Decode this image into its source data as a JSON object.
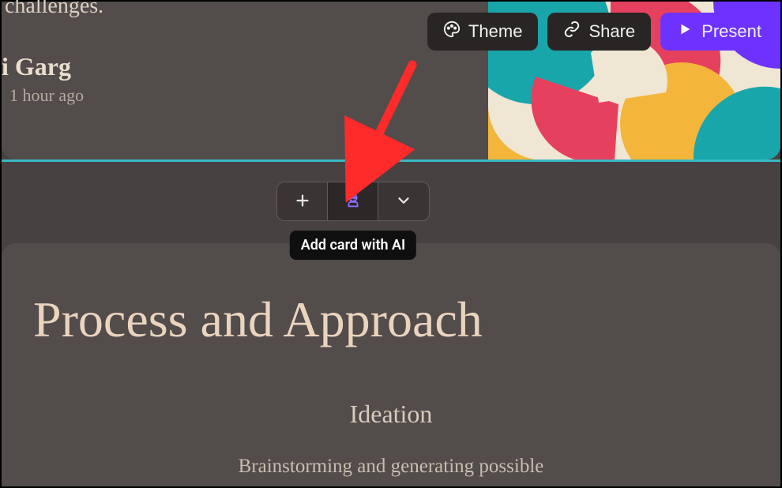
{
  "actions": {
    "theme": "Theme",
    "share": "Share",
    "present": "Present"
  },
  "header_card": {
    "truncated_line": "challenges.",
    "author": "i Garg",
    "timestamp": "1 hour ago"
  },
  "add_toolbar": {
    "tooltip": "Add card with AI"
  },
  "card2": {
    "title": "Process and Approach",
    "subheading": "Ideation",
    "body": "Brainstorming and generating possible"
  },
  "colors": {
    "accent": "#6e32ff",
    "divider": "#38b8c4"
  }
}
